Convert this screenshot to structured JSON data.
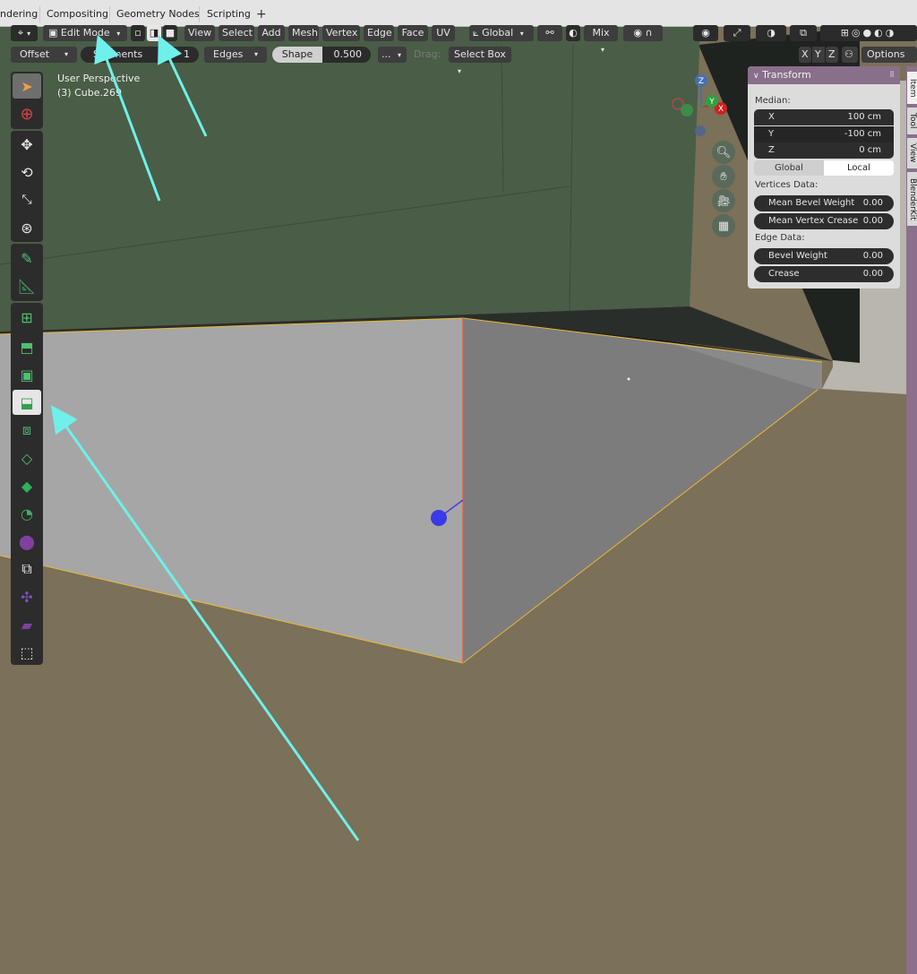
{
  "workspace_tabs": [
    "ndering",
    "Compositing",
    "Geometry Nodes",
    "Scripting"
  ],
  "workspace_add": "+",
  "header": {
    "mode": "Edit Mode",
    "menus": [
      "View",
      "Select",
      "Add",
      "Mesh",
      "Vertex",
      "Edge",
      "Face",
      "UV"
    ],
    "orientation": "Global",
    "proportional": "Mix"
  },
  "tool_settings": {
    "method": "Offset",
    "segments_label": "Segments",
    "segments_value": "1",
    "affect": "Edges",
    "shape_label": "Shape",
    "shape_value": "0.500",
    "more": "...",
    "drag_label": "Drag:",
    "drag_value": "Select Box",
    "axis_x": "X",
    "axis_y": "Y",
    "axis_z": "Z",
    "options": "Options"
  },
  "viewport": {
    "perspective": "User Perspective",
    "object": "(3) Cube.269"
  },
  "gizmo": {
    "x": "X",
    "y": "Y",
    "z": "Z"
  },
  "transform_panel": {
    "title": "Transform",
    "median_label": "Median:",
    "x_label": "X",
    "x_value": "100 cm",
    "y_label": "Y",
    "y_value": "-100 cm",
    "z_label": "Z",
    "z_value": "0 cm",
    "global": "Global",
    "local": "Local",
    "vertices_label": "Vertices Data:",
    "mean_bevel_label": "Mean Bevel Weight",
    "mean_bevel_value": "0.00",
    "mean_crease_label": "Mean Vertex Crease",
    "mean_crease_value": "0.00",
    "edge_label": "Edge Data:",
    "bevel_label": "Bevel Weight",
    "bevel_value": "0.00",
    "crease_label": "Crease",
    "crease_value": "0.00"
  },
  "side_tabs": [
    "Item",
    "Tool",
    "View",
    "BlenderKit"
  ],
  "colors": {
    "accent_arrow": "#6ff0ea",
    "panel_header": "#8a6f8a",
    "wall": "#4a5f48",
    "floor": "#7d7259",
    "cube_light": "#a9a9a9",
    "cube_dark": "#7f7f7f",
    "selected_edge": "#e26040",
    "edge_outline": "#e8b838"
  }
}
